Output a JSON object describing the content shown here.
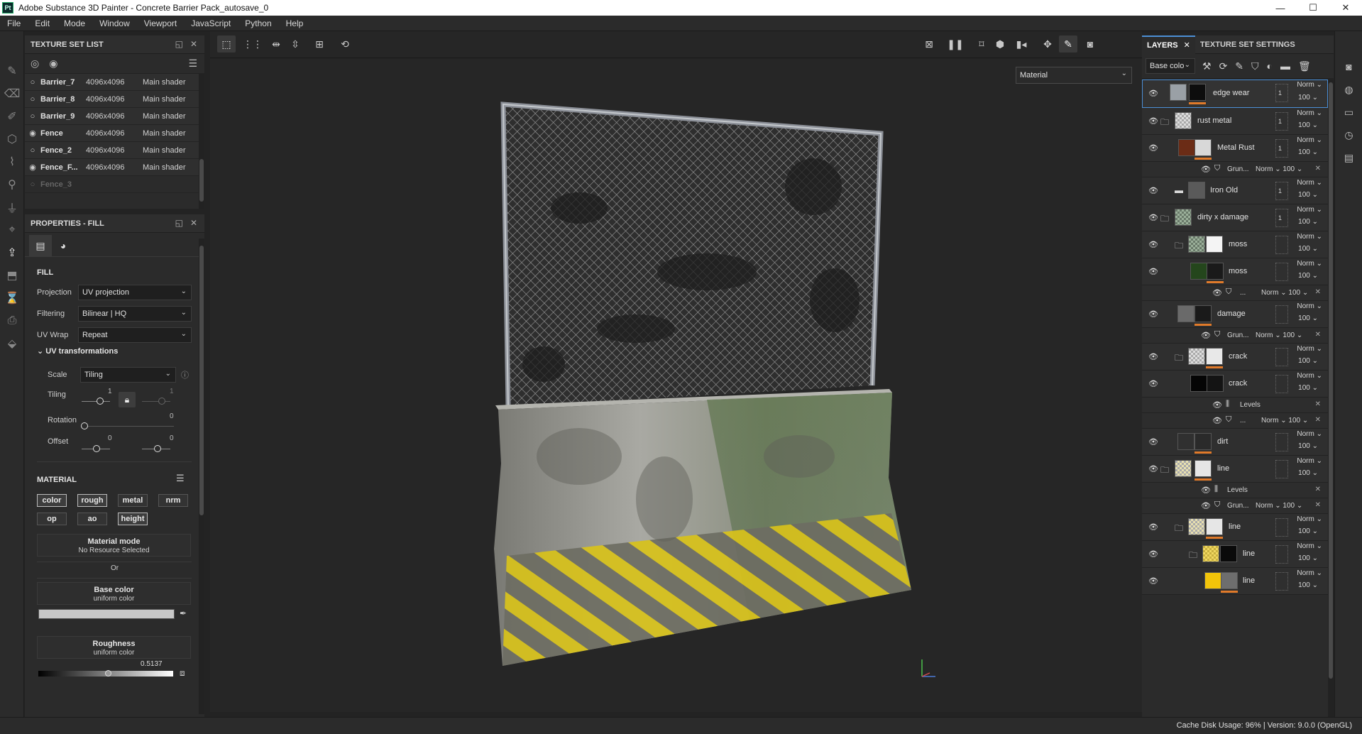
{
  "window": {
    "app_icon": "Pt",
    "title": "Adobe Substance 3D Painter - Concrete Barrier Pack_autosave_0",
    "minimize": "—",
    "maximize": "☐",
    "close": "✕"
  },
  "menu": [
    "File",
    "Edit",
    "Mode",
    "Window",
    "Viewport",
    "JavaScript",
    "Python",
    "Help"
  ],
  "texture_set_list": {
    "title": "TEXTURE SET LIST",
    "rows": [
      {
        "name": "Barrier_7",
        "resolution": "4096x4096",
        "shader": "Main shader",
        "visible": false
      },
      {
        "name": "Barrier_8",
        "resolution": "4096x4096",
        "shader": "Main shader",
        "visible": false
      },
      {
        "name": "Barrier_9",
        "resolution": "4096x4096",
        "shader": "Main shader",
        "visible": false
      },
      {
        "name": "Fence",
        "resolution": "4096x4096",
        "shader": "Main shader",
        "visible": true
      },
      {
        "name": "Fence_2",
        "resolution": "4096x4096",
        "shader": "Main shader",
        "visible": false
      },
      {
        "name": "Fence_F...",
        "resolution": "4096x4096",
        "shader": "Main shader",
        "visible": true
      },
      {
        "name": "Fence_3",
        "resolution": "",
        "shader": "",
        "visible": false,
        "disabled": true
      }
    ]
  },
  "properties": {
    "title": "PROPERTIES - FILL",
    "fill_label": "FILL",
    "projection_label": "Projection",
    "projection_value": "UV projection",
    "filtering_label": "Filtering",
    "filtering_value": "Bilinear | HQ",
    "uvwrap_label": "UV Wrap",
    "uvwrap_value": "Repeat",
    "uv_transformations_label": "UV transformations",
    "scale_label": "Scale",
    "scale_value": "Tiling",
    "tiling_label": "Tiling",
    "tiling_u": "1",
    "tiling_v": "1",
    "rotation_label": "Rotation",
    "rotation_value": "0",
    "offset_label": "Offset",
    "offset_u": "0",
    "offset_v": "0",
    "material_label": "MATERIAL",
    "channels": [
      "color",
      "rough",
      "metal",
      "nrm",
      "op",
      "ao",
      "height"
    ],
    "material_mode_title": "Material mode",
    "material_mode_value": "No Resource Selected",
    "or_label": "Or",
    "base_color_title": "Base color",
    "base_color_value": "uniform color",
    "base_color_hex": "#c8c8c8",
    "roughness_title": "Roughness",
    "roughness_value": "uniform color",
    "roughness_number": "0.5137",
    "roughness_level": 0.5137
  },
  "viewport": {
    "mode_dropdown": "Material"
  },
  "right_tabs": {
    "layers": "LAYERS",
    "texture_set_settings": "TEXTURE SET SETTINGS"
  },
  "layers_toolbar": {
    "channel": "Base colo"
  },
  "layers": {
    "items": [
      {
        "name": "edge wear",
        "blend": "Norm",
        "opacity": "100",
        "count": "1"
      },
      {
        "name": "rust metal",
        "blend": "Norm",
        "opacity": "100",
        "count": "1"
      },
      {
        "name": "Metal Rust",
        "blend": "Norm",
        "opacity": "100",
        "count": "1"
      },
      {
        "name": "Grun...",
        "blend": "Norm",
        "opacity": "100"
      },
      {
        "name": "Iron Old",
        "blend": "Norm",
        "opacity": "100",
        "count": "1"
      },
      {
        "name": "dirty x damage",
        "blend": "Norm",
        "opacity": "100",
        "count": "1"
      },
      {
        "name": "moss",
        "blend": "Norm",
        "opacity": "100"
      },
      {
        "name": "moss",
        "blend": "Norm",
        "opacity": "100"
      },
      {
        "name": "...",
        "blend": "Norm",
        "opacity": "100"
      },
      {
        "name": "damage",
        "blend": "Norm",
        "opacity": "100"
      },
      {
        "name": "Grun...",
        "blend": "Norm",
        "opacity": "100"
      },
      {
        "name": "crack",
        "blend": "Norm",
        "opacity": "100"
      },
      {
        "name": "crack",
        "blend": "Norm",
        "opacity": "100"
      },
      {
        "name": "Levels"
      },
      {
        "name": "...",
        "blend": "Norm",
        "opacity": "100"
      },
      {
        "name": "dirt",
        "blend": "Norm",
        "opacity": "100"
      },
      {
        "name": "line",
        "blend": "Norm",
        "opacity": "100"
      },
      {
        "name": "Levels"
      },
      {
        "name": "Grun...",
        "blend": "Norm",
        "opacity": "100"
      },
      {
        "name": "line",
        "blend": "Norm",
        "opacity": "100"
      },
      {
        "name": "line",
        "blend": "Norm",
        "opacity": "100"
      },
      {
        "name": "line",
        "blend": "Norm",
        "opacity": "100"
      }
    ]
  },
  "status": {
    "text": "Cache Disk Usage:   96% | Version: 9.0.0 (OpenGL)"
  },
  "colors": {
    "accent": "#4c8fd6",
    "mask_bar": "#e07a2a",
    "hazard_yellow": "#d8c21a",
    "panel_bg": "#2b2b2b"
  }
}
